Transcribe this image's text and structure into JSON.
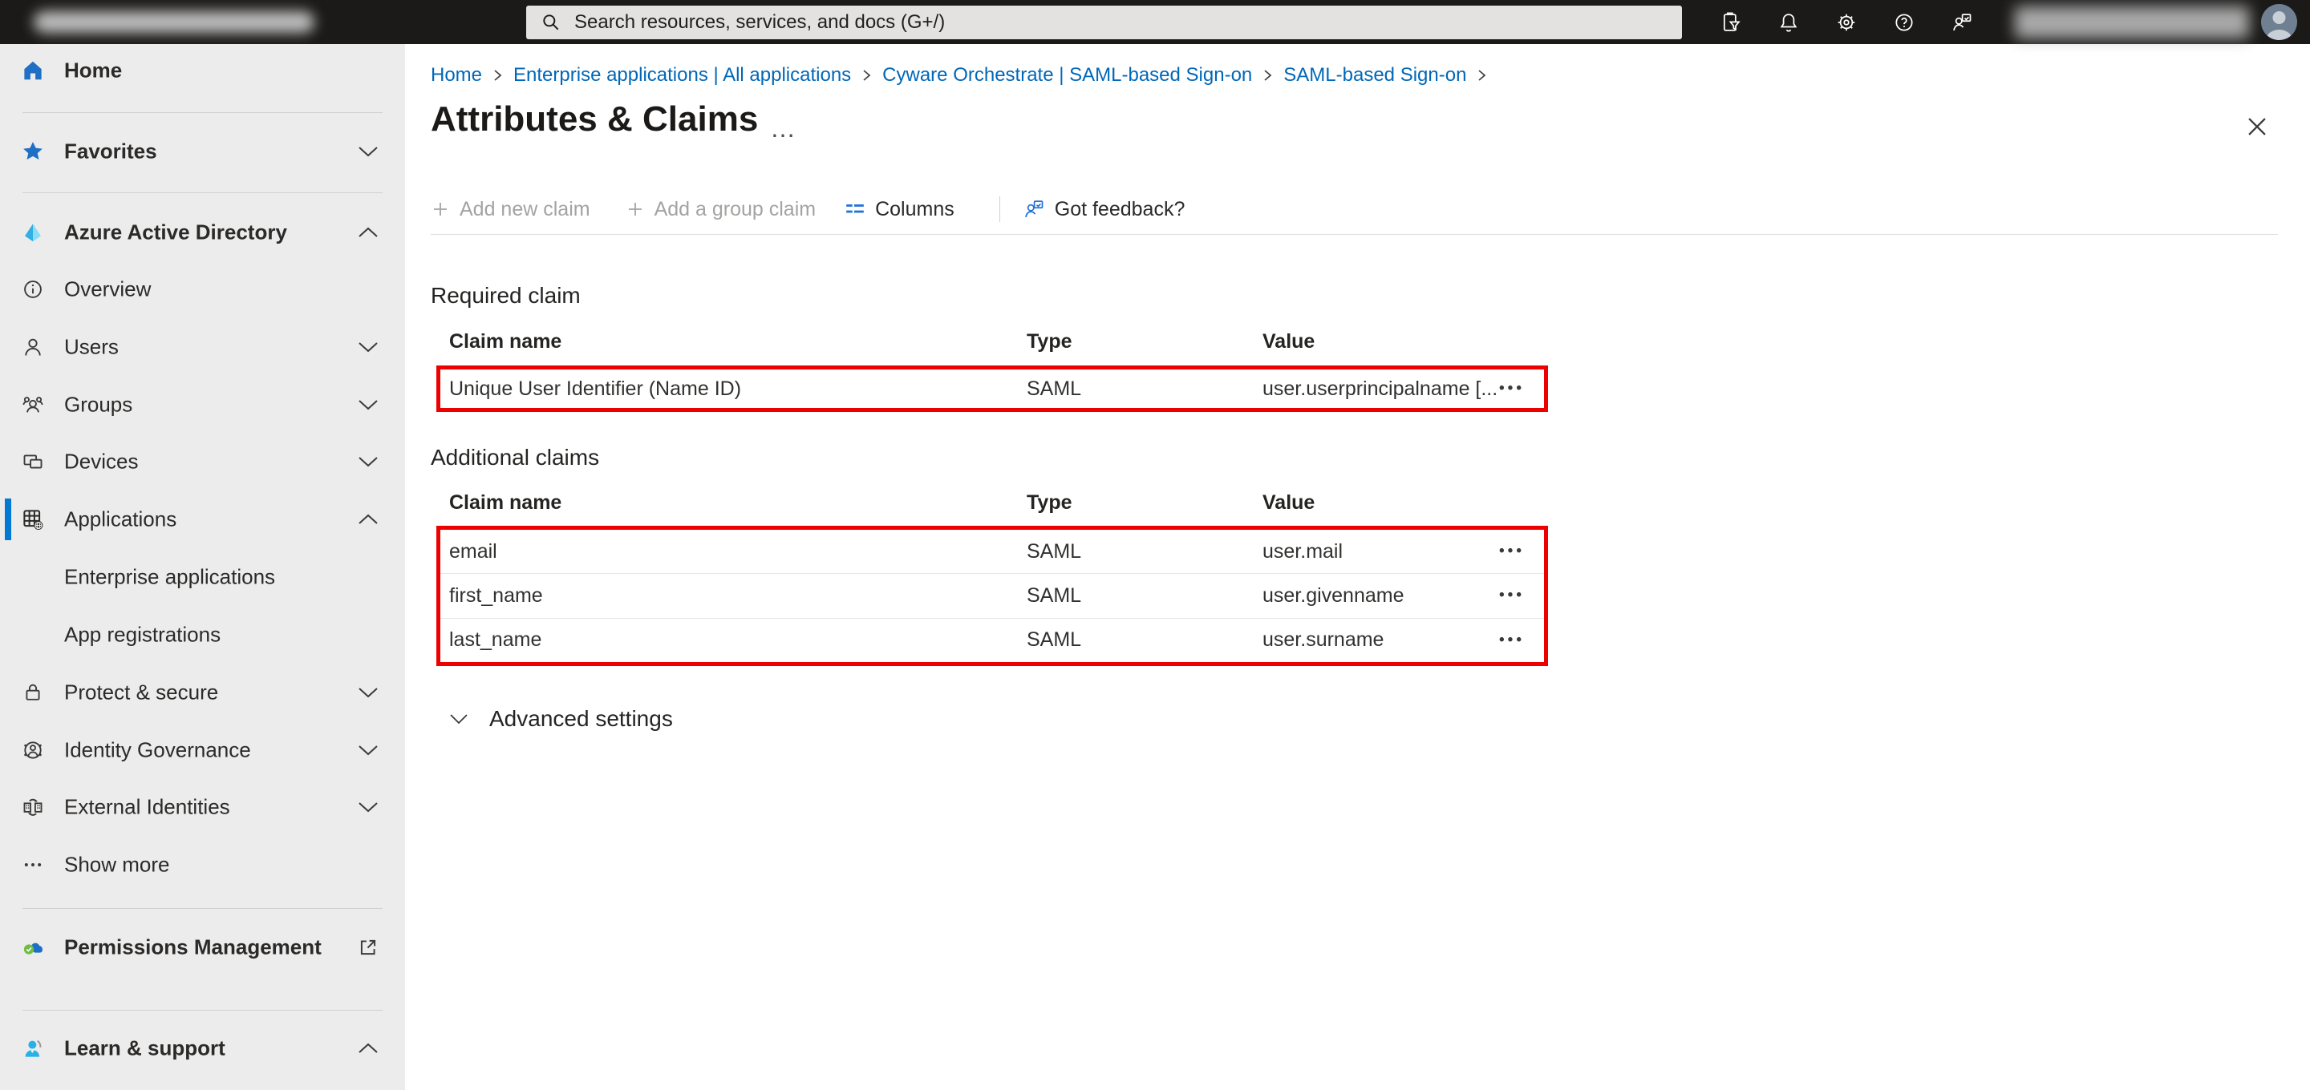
{
  "colors": {
    "accent": "#0078d4",
    "link_blue": "#0067b8",
    "highlight_red": "#ec0000",
    "topbar_bg": "#1b1a19",
    "sidebar_bg": "#ececec"
  },
  "icons": {
    "row_menu": "•••",
    "title_menu": "…"
  },
  "topbar": {
    "search_placeholder": "Search resources, services, and docs (G+/)"
  },
  "sidebar": {
    "items": [
      {
        "label": "Home"
      },
      {
        "label": "Favorites",
        "chevron": "down"
      },
      {
        "label": "Azure Active Directory",
        "chevron": "up"
      },
      {
        "label": "Overview"
      },
      {
        "label": "Users",
        "chevron": "down"
      },
      {
        "label": "Groups",
        "chevron": "down"
      },
      {
        "label": "Devices",
        "chevron": "down"
      },
      {
        "label": "Applications",
        "chevron": "up",
        "selected": true
      },
      {
        "label": "Enterprise applications"
      },
      {
        "label": "App registrations"
      },
      {
        "label": "Protect & secure",
        "chevron": "down"
      },
      {
        "label": "Identity Governance",
        "chevron": "down"
      },
      {
        "label": "External Identities",
        "chevron": "down"
      },
      {
        "label": "Show more"
      },
      {
        "label": "Permissions Management",
        "external_link": true
      },
      {
        "label": "Learn & support",
        "chevron": "up"
      }
    ]
  },
  "breadcrumb": {
    "items": [
      "Home",
      "Enterprise applications | All applications",
      "Cyware Orchestrate | SAML-based Sign-on",
      "SAML-based Sign-on"
    ]
  },
  "page": {
    "title": "Attributes & Claims"
  },
  "toolbar": {
    "add_new_claim": "Add new claim",
    "add_group_claim": "Add a group claim",
    "columns": "Columns",
    "got_feedback": "Got feedback?"
  },
  "required_claim": {
    "heading": "Required claim",
    "columns": [
      "Claim name",
      "Type",
      "Value"
    ],
    "rows": [
      {
        "claim_name": "Unique User Identifier (Name ID)",
        "type": "SAML",
        "value": "user.userprincipalname [..."
      }
    ]
  },
  "additional_claims": {
    "heading": "Additional claims",
    "columns": [
      "Claim name",
      "Type",
      "Value"
    ],
    "rows": [
      {
        "claim_name": "email",
        "type": "SAML",
        "value": "user.mail"
      },
      {
        "claim_name": "first_name",
        "type": "SAML",
        "value": "user.givenname"
      },
      {
        "claim_name": "last_name",
        "type": "SAML",
        "value": "user.surname"
      }
    ]
  },
  "advanced_settings": {
    "label": "Advanced settings"
  }
}
